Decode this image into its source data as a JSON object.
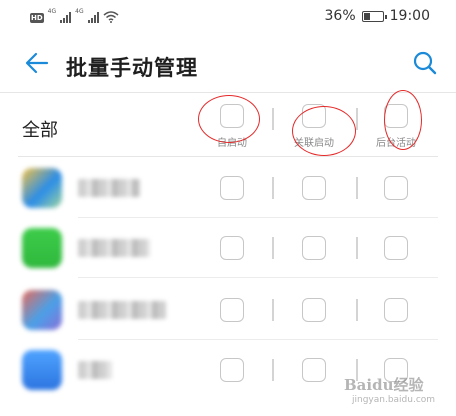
{
  "status_bar": {
    "hd": "HD",
    "sim1_network": "4G",
    "sim2_network": "4G",
    "battery_percent": "36%",
    "battery_level": 0.36,
    "time": "19:00"
  },
  "header": {
    "title": "批量手动管理",
    "back_icon": "arrow-left-icon",
    "search_icon": "search-icon"
  },
  "columns": {
    "all_label": "全部",
    "auto_launch": "自启动",
    "associated_launch": "关联启动",
    "background_activity": "后台活动"
  },
  "apps": [
    {
      "name": "",
      "icon_colors": [
        "#f5c242",
        "#2b8de8",
        "#9fd6a0"
      ],
      "checked": [
        false,
        false,
        false
      ]
    },
    {
      "name": "",
      "icon_colors": [
        "#3dcc4a",
        "#2fb83d"
      ],
      "checked": [
        false,
        false,
        false
      ]
    },
    {
      "name": "",
      "icon_colors": [
        "#e86a5a",
        "#4aa0e8",
        "#8a6fd8"
      ],
      "checked": [
        false,
        false,
        false
      ]
    },
    {
      "name": "",
      "icon_colors": [
        "#4fa3ff",
        "#2b74e0"
      ],
      "checked": [
        false,
        false,
        false
      ]
    }
  ],
  "watermark": {
    "text": "Baidu经验",
    "sub": "jingyan.baidu.com"
  },
  "colors": {
    "accent": "#1a8ad9",
    "annotation": "#e52a2a"
  }
}
